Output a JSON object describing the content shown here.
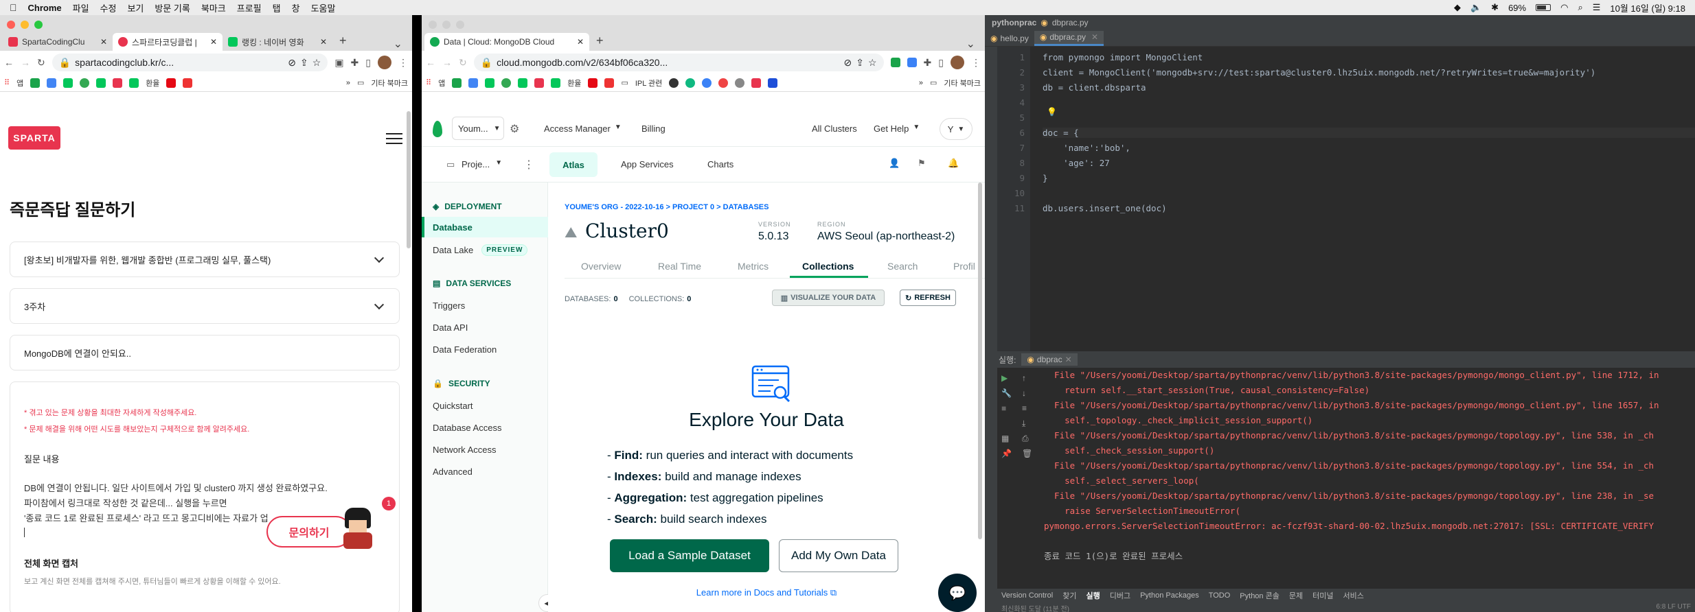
{
  "menubar": {
    "app": "Chrome",
    "items": [
      "파일",
      "수정",
      "보기",
      "방문 기록",
      "북마크",
      "프로필",
      "탭",
      "창",
      "도움말"
    ],
    "battery": "69%",
    "datetime": "10월 16일 (일)  9:18"
  },
  "left_browser": {
    "tabs": [
      {
        "label": "SpartaCodingClu",
        "color": "#e8344e"
      },
      {
        "label": "스파르타코딩클럽 |",
        "color": "#e8344e"
      },
      {
        "label": "랭킹 : 네이버 영화",
        "color": "#03c75a"
      }
    ],
    "url": "spartacodingclub.kr/c...",
    "bookmarks_other": "기타 북마크",
    "bookmark_label": "앱",
    "bookmark_label2": "환율",
    "page": {
      "logo": "SPARTA",
      "title": "즉문즉답 질문하기",
      "select_course": "[왕초보] 비개발자를 위한, 웹개발 종합반 (프로그래밍 실무, 풀스택)",
      "select_week": "3주차",
      "question_title": "MongoDB에 연결이 안되요..",
      "hint1": "* 겪고 있는 문제 상황을 최대한 자세하게 작성해주세요.",
      "hint2": "* 문제 해결을 위해 어떤 시도를 해보았는지 구체적으로 함께 알려주세요.",
      "section_label": "질문 내용",
      "body_line1": "DB에 연결이 안됩니다. 일단 사이트에서 가입 및 cluster0 까지 생성 완료하였구요.",
      "body_line2": "파이참에서 링크대로 작성한 것 같은데...  실행을 누르면",
      "body_line3": "'종료 코드 1로 완료된 프로세스' 라고 뜨고 몽고디비에는 자료가 업",
      "capture_label": "전체 화면 캡처",
      "capture_hint": "보고 계신 화면 전체를 캡쳐해 주시면, 튜터님들이 빠르게 상황을 이해할 수 있어요.",
      "inquiry_button": "문의하기",
      "badge": "1"
    }
  },
  "mid_browser": {
    "tab": "Data | Cloud: MongoDB Cloud",
    "url": "cloud.mongodb.com/v2/634bf06ca320...",
    "bookmarks": [
      "앱",
      "환율",
      "IPL 관련"
    ],
    "bookmarks_other": "기타 북마크",
    "topnav": {
      "org": "Youm...",
      "access_manager": "Access Manager",
      "billing": "Billing",
      "all_clusters": "All Clusters",
      "get_help": "Get Help",
      "user": "Y"
    },
    "secondnav": {
      "project": "Proje...",
      "tabs": [
        "Atlas",
        "App Services",
        "Charts"
      ]
    },
    "sidebar": {
      "deployment": "DEPLOYMENT",
      "database": "Database",
      "data_lake": "Data Lake",
      "preview": "PREVIEW",
      "data_services": "DATA SERVICES",
      "triggers": "Triggers",
      "data_api": "Data API",
      "data_federation": "Data Federation",
      "security": "SECURITY",
      "quickstart": "Quickstart",
      "database_access": "Database Access",
      "network_access": "Network Access",
      "advanced": "Advanced"
    },
    "main": {
      "breadcrumb": "YOUME'S ORG - 2022-10-16 > PROJECT 0 > DATABASES",
      "cluster_name": "Cluster0",
      "version_label": "VERSION",
      "version": "5.0.13",
      "region_label": "REGION",
      "region": "AWS Seoul (ap-northeast-2)",
      "tabs": [
        "Overview",
        "Real Time",
        "Metrics",
        "Collections",
        "Search",
        "Profil"
      ],
      "databases_label": "DATABASES:",
      "databases_count": "0",
      "collections_label": "COLLECTIONS:",
      "collections_count": "0",
      "visualize": "VISUALIZE YOUR DATA",
      "refresh": "REFRESH",
      "explore_title": "Explore Your Data",
      "bullets": [
        {
          "b": "Find:",
          "t": " run queries and interact with documents"
        },
        {
          "b": "Indexes:",
          "t": " build and manage indexes"
        },
        {
          "b": "Aggregation:",
          "t": " test aggregation pipelines"
        },
        {
          "b": "Search:",
          "t": " build search indexes"
        }
      ],
      "load_sample": "Load a Sample Dataset",
      "add_own": "Add My Own Data",
      "learn_more": "Learn more in Docs and Tutorials"
    }
  },
  "ide": {
    "project": "pythonprac",
    "file": "dbprac.py",
    "tabs": [
      "hello.py",
      "dbprac.py"
    ],
    "line_numbers": [
      "1",
      "2",
      "3",
      "4",
      "5",
      "6",
      "7",
      "8",
      "9",
      "10",
      "11"
    ],
    "code_lines": [
      "from pymongo import MongoClient",
      "client = MongoClient('mongodb+srv://test:sparta@cluster0.lhz5uix.mongodb.net/?retryWrites=true&w=majority')",
      "db = client.dbsparta",
      "",
      "",
      "doc = {",
      "    'name':'bob',",
      "    'age': 27",
      "}",
      "",
      "db.users.insert_one(doc)"
    ],
    "run_label": "실행:",
    "run_tab": "dbprac",
    "console": [
      {
        "text": "  File \"/Users/yoomi/Desktop/sparta/pythonprac/venv/lib/python3.8/site-packages/pymongo/mongo_client.py\", line 1712, in",
        "cls": "red"
      },
      {
        "text": "    return self.__start_session(True, causal_consistency=False)",
        "cls": "red"
      },
      {
        "text": "  File \"/Users/yoomi/Desktop/sparta/pythonprac/venv/lib/python3.8/site-packages/pymongo/mongo_client.py\", line 1657, in",
        "cls": "red"
      },
      {
        "text": "    self._topology._check_implicit_session_support()",
        "cls": "red"
      },
      {
        "text": "  File \"/Users/yoomi/Desktop/sparta/pythonprac/venv/lib/python3.8/site-packages/pymongo/topology.py\", line 538, in _ch",
        "cls": "red"
      },
      {
        "text": "    self._check_session_support()",
        "cls": "red"
      },
      {
        "text": "  File \"/Users/yoomi/Desktop/sparta/pythonprac/venv/lib/python3.8/site-packages/pymongo/topology.py\", line 554, in _ch",
        "cls": "red"
      },
      {
        "text": "    self._select_servers_loop(",
        "cls": "red"
      },
      {
        "text": "  File \"/Users/yoomi/Desktop/sparta/pythonprac/venv/lib/python3.8/site-packages/pymongo/topology.py\", line 238, in _se",
        "cls": "red"
      },
      {
        "text": "    raise ServerSelectionTimeoutError(",
        "cls": "red"
      },
      {
        "text": "pymongo.errors.ServerSelectionTimeoutError: ac-fczf93t-shard-00-02.lhz5uix.mongodb.net:27017: [SSL: CERTIFICATE_VERIFY",
        "cls": "red"
      },
      {
        "text": "",
        "cls": ""
      },
      {
        "text": "종료 코드 1(으)로 완료된 프로세스",
        "cls": "plain"
      }
    ],
    "bottom_tabs": [
      "Version Control",
      "찾기",
      "실행",
      "디버그",
      "Python Packages",
      "TODO",
      "Python 콘솔",
      "문제",
      "터미널",
      "서비스"
    ],
    "status_left": "최신화된 도달 (11분 전)",
    "status_right": "6:8   LF   UTF"
  }
}
